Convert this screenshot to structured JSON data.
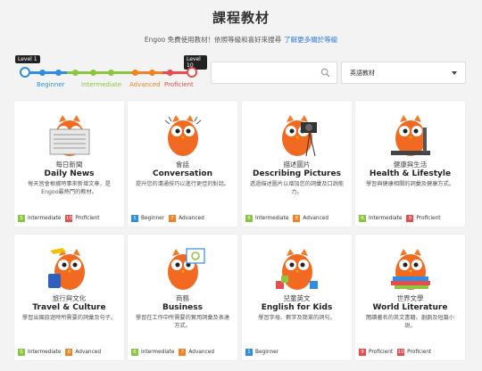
{
  "header": {
    "title": "課程教材",
    "subtitle": "Engoo 免費使用教材！依照等級和喜好來搜尋",
    "link": "了解更多關於等級"
  },
  "level_filter": {
    "min_label": "Level 1",
    "max_label": "Level 10",
    "segments": [
      "Beginner",
      "Intermediate",
      "Advanced",
      "Proficient"
    ],
    "segment_colors": [
      "#2f8ee3",
      "#8cc63f",
      "#f58220",
      "#e84c4c"
    ]
  },
  "search": {
    "placeholder": "",
    "value": ""
  },
  "category_select": {
    "value": "英語教材"
  },
  "level_colors": {
    "1": "#2f8ee3",
    "4": "#8cc63f",
    "5": "#8cc63f",
    "6": "#8cc63f",
    "7": "#f58220",
    "8": "#f58220",
    "9": "#e84c4c",
    "10": "#e84c4c"
  },
  "cards": [
    {
      "zh": "每日新聞",
      "en": "Daily News",
      "desc": "每天皆會根據時事來新增文章，是Engoo最熱門的教材。",
      "icon": "newspaper-owl-icon",
      "badges": [
        {
          "num": "5",
          "label": "Intermediate"
        },
        {
          "num": "10",
          "label": "Proficient"
        }
      ]
    },
    {
      "zh": "會話",
      "en": "Conversation",
      "desc": "提升您的溝通技巧以進行更佳的對話。",
      "icon": "talking-owl-icon",
      "badges": [
        {
          "num": "1",
          "label": "Beginner"
        },
        {
          "num": "7",
          "label": "Advanced"
        }
      ]
    },
    {
      "zh": "描述圖片",
      "en": "Describing Pictures",
      "desc": "透過描述圖片以增加您的詞彙及口說能力。",
      "icon": "camera-owl-icon",
      "badges": [
        {
          "num": "4",
          "label": "Intermediate"
        },
        {
          "num": "8",
          "label": "Advanced"
        }
      ]
    },
    {
      "zh": "健康與生活",
      "en": "Health & Lifestyle",
      "desc": "學習與健康相關的詞彙及健康方式。",
      "icon": "treadmill-owl-icon",
      "badges": [
        {
          "num": "6",
          "label": "Intermediate"
        },
        {
          "num": "9",
          "label": "Proficient"
        }
      ]
    },
    {
      "zh": "旅行與文化",
      "en": "Travel & Culture",
      "desc": "學習出國旅遊時所需要的詞彙及句子。",
      "icon": "travel-owl-icon",
      "badges": [
        {
          "num": "5",
          "label": "Intermediate"
        },
        {
          "num": "8",
          "label": "Advanced"
        }
      ]
    },
    {
      "zh": "商務",
      "en": "Business",
      "desc": "學習在工作中所需要的實用詞彙及表達方式。",
      "icon": "presentation-owl-icon",
      "badges": [
        {
          "num": "6",
          "label": "Intermediate"
        },
        {
          "num": "7",
          "label": "Advanced"
        }
      ]
    },
    {
      "zh": "兒童英文",
      "en": "English for Kids",
      "desc": "學習字母、數字及簡單的詞句。",
      "icon": "kids-owl-icon",
      "badges": [
        {
          "num": "1",
          "label": "Beginner"
        }
      ]
    },
    {
      "zh": "世界文學",
      "en": "World Literature",
      "desc": "閱讀著名的英文書籍、劇劇及短篇小說。",
      "icon": "books-owl-icon",
      "badges": [
        {
          "num": "9",
          "label": "Proficient"
        },
        {
          "num": "10",
          "label": "Proficient"
        }
      ]
    }
  ]
}
